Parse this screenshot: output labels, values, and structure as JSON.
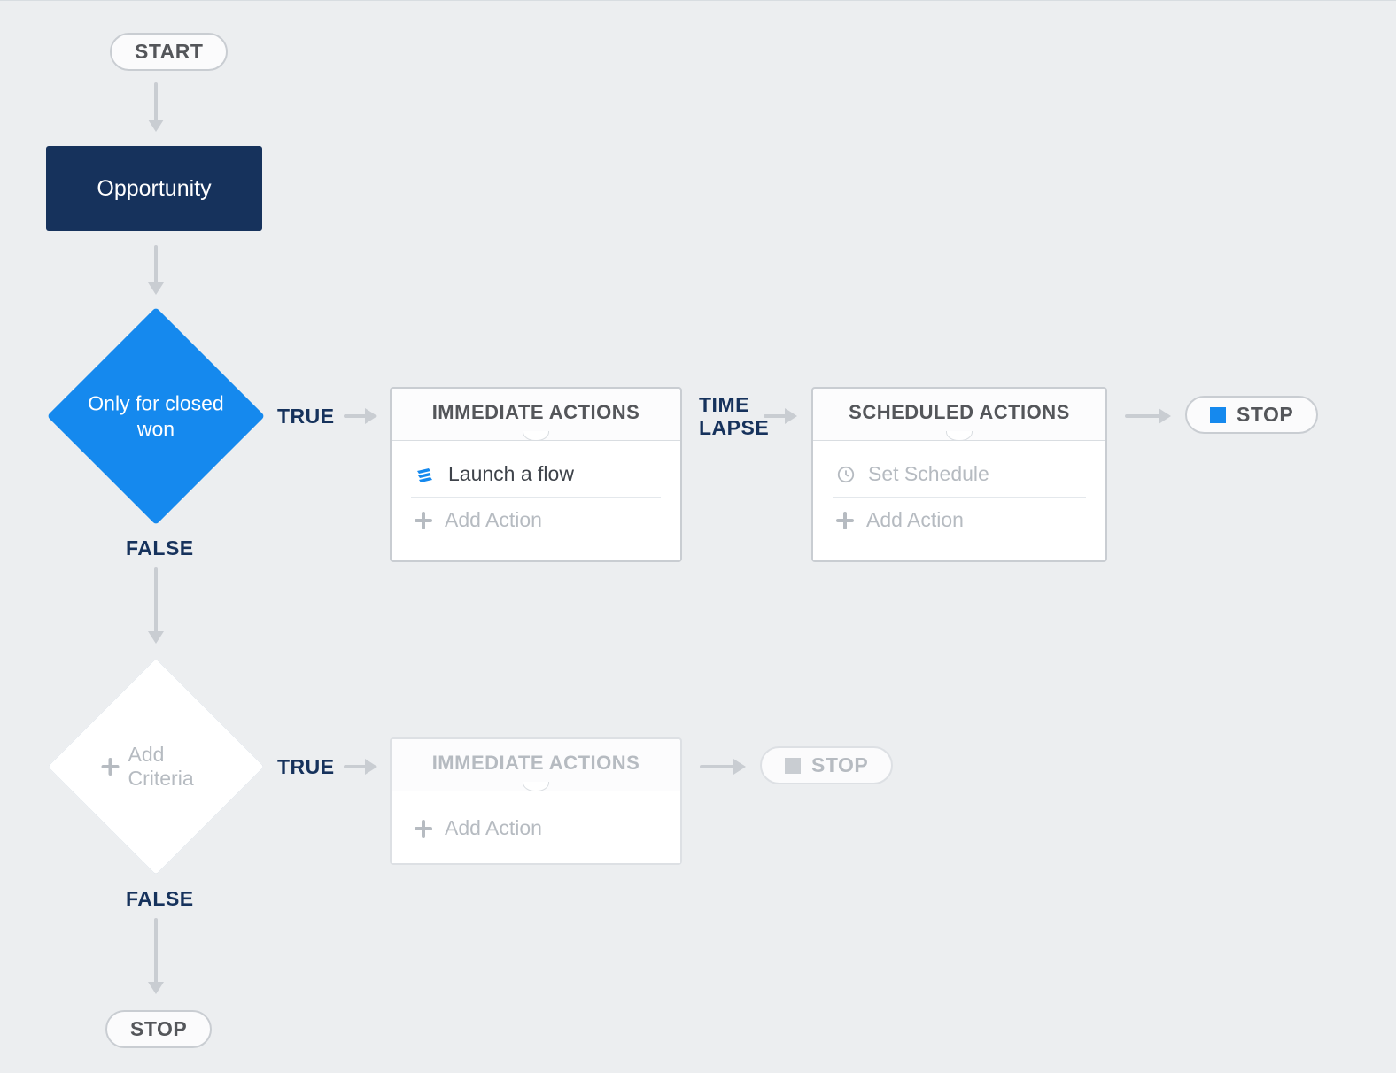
{
  "start_label": "START",
  "object_label": "Opportunity",
  "criteria1_label": "Only for closed won",
  "true_label": "TRUE",
  "false_label": "FALSE",
  "time_lapse_label": "TIME\nLAPSE",
  "immediate_actions_title": "IMMEDIATE ACTIONS",
  "scheduled_actions_title": "SCHEDULED ACTIONS",
  "launch_flow_label": "Launch a flow",
  "set_schedule_label": "Set Schedule",
  "add_action_label": "Add Action",
  "add_criteria_label": "Add Criteria",
  "stop_label": "STOP"
}
